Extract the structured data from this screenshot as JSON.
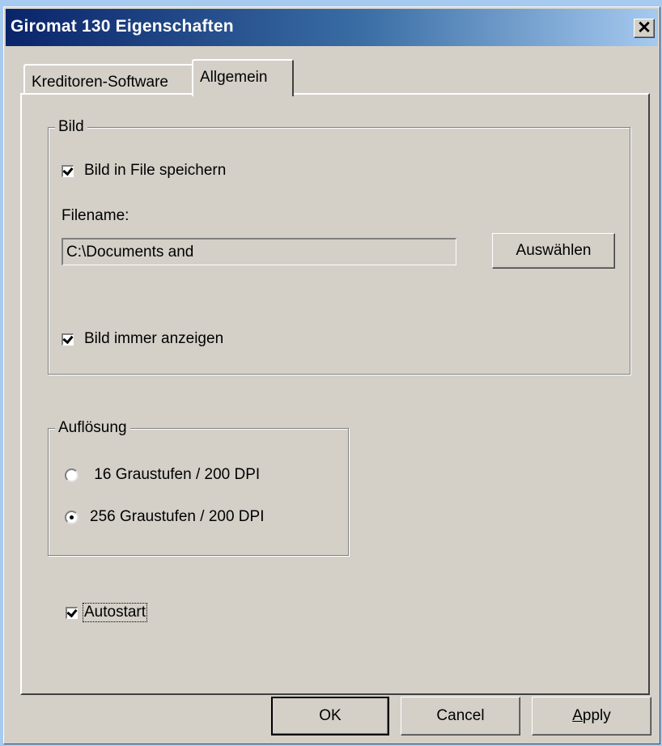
{
  "window": {
    "title": "Giromat 130 Eigenschaften",
    "close_glyph": "✕"
  },
  "tabs": [
    {
      "label": "Kreditoren-Software",
      "active": false
    },
    {
      "label": "Allgemein",
      "active": true
    }
  ],
  "bild": {
    "group_label": "Bild",
    "save_to_file": {
      "label": "Bild in File speichern",
      "checked": true
    },
    "filename_label": "Filename:",
    "filename_value": "C:\\Documents and",
    "choose_button": "Auswählen",
    "always_show": {
      "label": "Bild immer anzeigen",
      "checked": true
    }
  },
  "aufloesung": {
    "group_label": "Auflösung",
    "options": [
      {
        "label": " 16 Graustufen / 200 DPI",
        "selected": false
      },
      {
        "label": "256 Graustufen / 200 DPI",
        "selected": true
      }
    ]
  },
  "autostart": {
    "label": "Autostart",
    "checked": true
  },
  "buttons": {
    "ok": "OK",
    "cancel": "Cancel",
    "apply_first": "A",
    "apply_rest": "pply"
  }
}
